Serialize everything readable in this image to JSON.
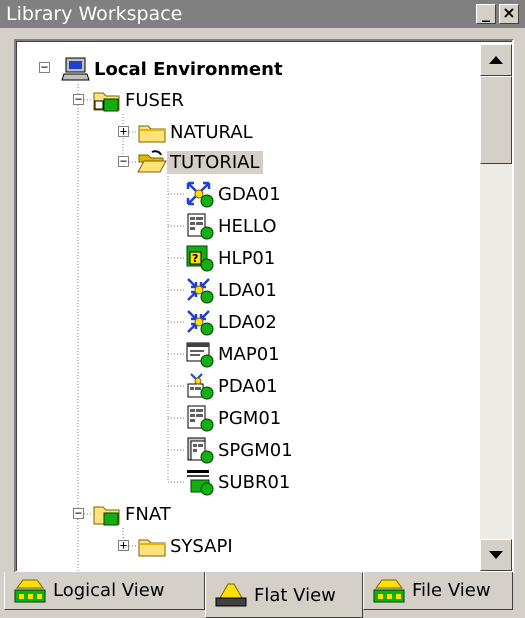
{
  "window": {
    "title": "Library Workspace",
    "minimize_glyph": "_",
    "close_glyph": "×"
  },
  "tree": {
    "root": {
      "label": "Local Environment"
    },
    "libraries": [
      {
        "label": "FUSER"
      },
      {
        "label": "FNAT"
      }
    ],
    "fuser_children": [
      {
        "label": "NATURAL"
      },
      {
        "label": "TUTORIAL"
      }
    ],
    "tutorial_objects": [
      {
        "label": "GDA01",
        "icon": "global-data-area-icon"
      },
      {
        "label": "HELLO",
        "icon": "program-icon"
      },
      {
        "label": "HLP01",
        "icon": "helproutine-icon"
      },
      {
        "label": "LDA01",
        "icon": "local-data-area-icon"
      },
      {
        "label": "LDA02",
        "icon": "local-data-area-icon"
      },
      {
        "label": "MAP01",
        "icon": "map-icon"
      },
      {
        "label": "PDA01",
        "icon": "parameter-data-area-icon"
      },
      {
        "label": "PGM01",
        "icon": "program-icon"
      },
      {
        "label": "SPGM01",
        "icon": "subprogram-icon"
      },
      {
        "label": "SUBR01",
        "icon": "subroutine-icon"
      }
    ],
    "fnat_children": [
      {
        "label": "SYSAPI"
      }
    ],
    "expanders": {
      "plus": "+",
      "minus": "−"
    }
  },
  "tabs": [
    {
      "label": "Logical View",
      "icon": "logical-view-icon"
    },
    {
      "label": "Flat View",
      "icon": "flat-view-icon",
      "active": true
    },
    {
      "label": "File View",
      "icon": "file-view-icon"
    }
  ],
  "colors": {
    "titlebar": "#808080",
    "panel": "#d4d0c8",
    "folder": "#ffe27a",
    "folder_dark": "#e0b400",
    "green": "#10b010",
    "blue": "#2040d0"
  }
}
